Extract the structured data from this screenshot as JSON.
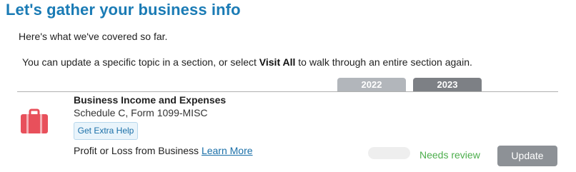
{
  "page": {
    "title": "Let's gather your business info",
    "covered_text": "Here's what we've covered so far.",
    "instruction_prefix": "You can update a specific topic in a section, or select ",
    "instruction_bold": "Visit All",
    "instruction_suffix": " to walk through an entire section again."
  },
  "years": {
    "tabs": [
      {
        "label": "2022"
      },
      {
        "label": "2023"
      }
    ]
  },
  "section": {
    "icon": "briefcase-icon",
    "icon_color": "#e8505b",
    "title": "Business Income and Expenses",
    "subtitle": "Schedule C, Form 1099-MISC",
    "help_button": "Get Extra Help",
    "item_label": "Profit or Loss from Business",
    "learn_more": "Learn More",
    "status": "Needs review",
    "status_color": "#4cae4c",
    "update_button": "Update"
  },
  "colors": {
    "title": "#1a7bb5",
    "tab_2022": "#b2b6bb",
    "tab_2023": "#7d8085",
    "update_button": "#8d9196"
  }
}
